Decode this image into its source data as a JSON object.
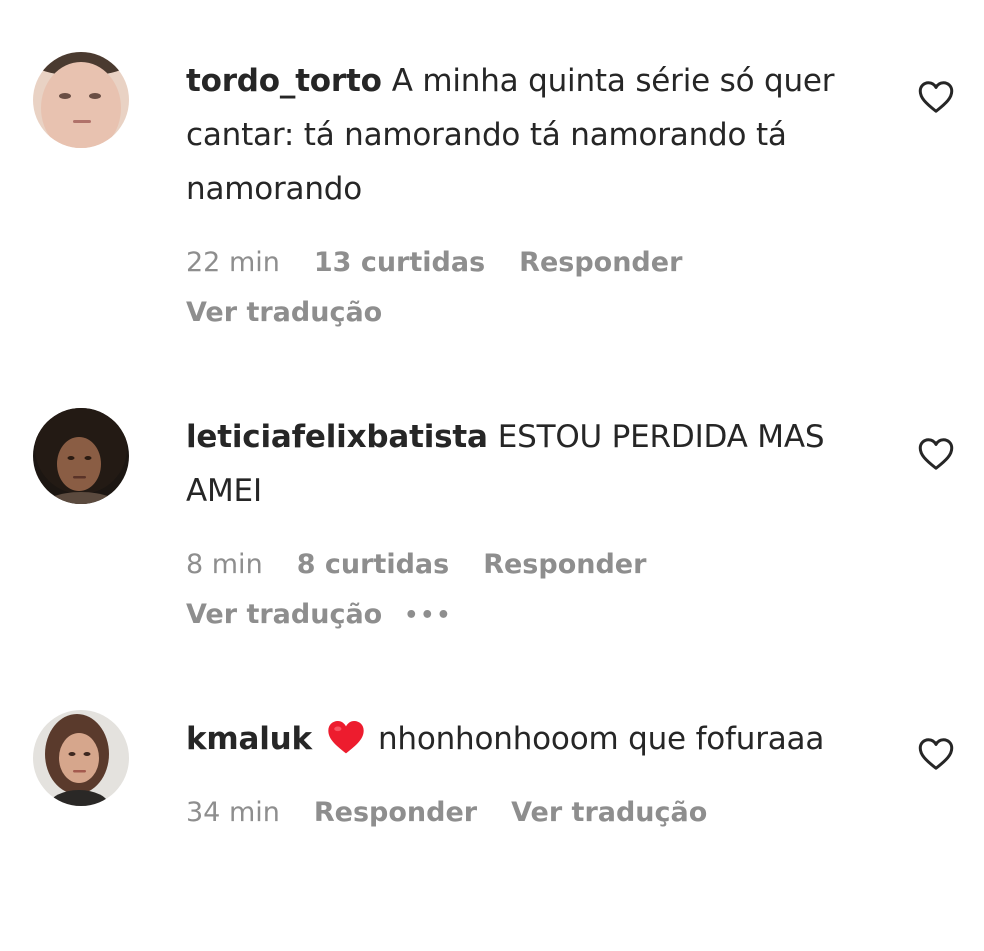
{
  "comments": [
    {
      "username": "tordo_torto",
      "text": "A minha quinta série só quer cantar: tá namorando tá namorando tá namorando",
      "time": "22 min",
      "likes": "13 curtidas",
      "reply": "Responder",
      "translate": "Ver tradução",
      "avatar_icon": "avatar-face",
      "like_icon": "heart-outline-icon"
    },
    {
      "username": "leticiafelixbatista",
      "text": "ESTOU PERDIDA MAS AMEI",
      "time": "8 min",
      "likes": "8 curtidas",
      "reply": "Responder",
      "translate": "Ver tradução",
      "more": "•••",
      "avatar_icon": "avatar-face",
      "like_icon": "heart-outline-icon"
    },
    {
      "username": "kmaluk",
      "emoji": "red-heart",
      "text": "nhonhonhooom que fofuraaa",
      "time": "34 min",
      "reply": "Responder",
      "translate": "Ver tradução",
      "avatar_icon": "avatar-face",
      "like_icon": "heart-outline-icon"
    }
  ],
  "colors": {
    "text": "#262626",
    "secondary": "#8e8e8e",
    "emoji_heart": "#ed1c2e",
    "background": "#ffffff"
  }
}
